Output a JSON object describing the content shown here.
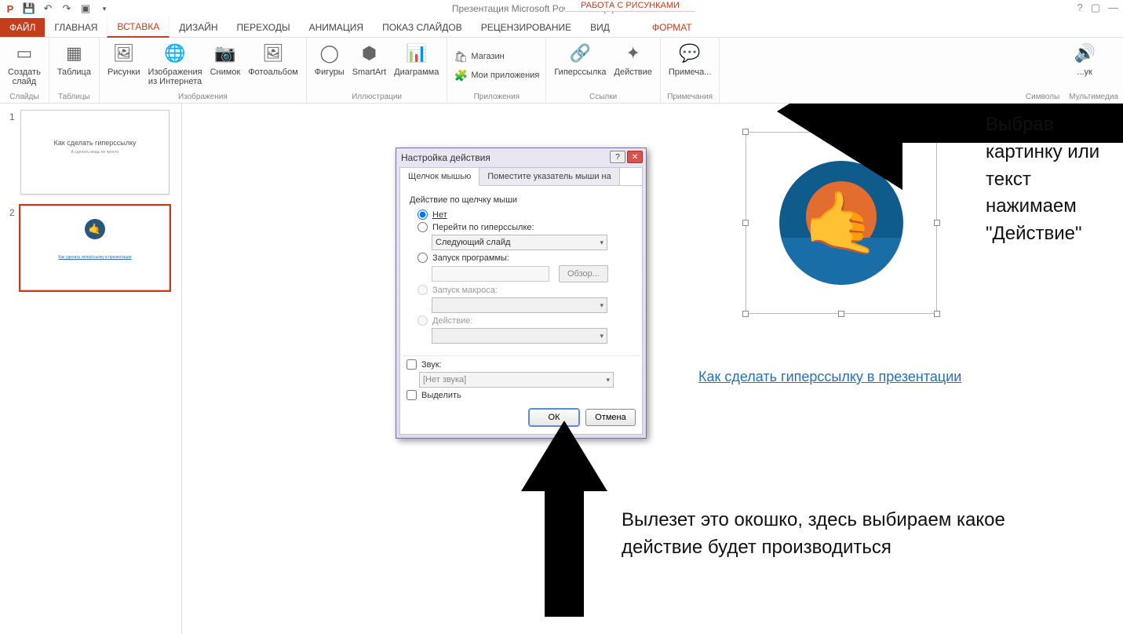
{
  "titlebar": {
    "title": "Презентация Microsoft PowerPoint (2) - PowerPoint",
    "tools_tab_group": "РАБОТА С РИСУНКАМИ"
  },
  "tabs": {
    "file": "ФАЙЛ",
    "home": "ГЛАВНАЯ",
    "insert": "ВСТАВКА",
    "design": "ДИЗАЙН",
    "transitions": "ПЕРЕХОДЫ",
    "animation": "АНИМАЦИЯ",
    "slideshow": "ПОКАЗ СЛАЙДОВ",
    "review": "РЕЦЕНЗИРОВАНИЕ",
    "view": "ВИД",
    "format": "ФОРМАТ"
  },
  "ribbon": {
    "slides": {
      "new_slide": "Создать\nслайд",
      "group": "Слайды"
    },
    "tables": {
      "table": "Таблица",
      "group": "Таблицы"
    },
    "images": {
      "pictures": "Рисунки",
      "online": "Изображения\nиз Интернета",
      "screenshot": "Снимок",
      "album": "Фотоальбом",
      "group": "Изображения"
    },
    "illustr": {
      "shapes": "Фигуры",
      "smartart": "SmartArt",
      "chart": "Диаграмма",
      "group": "Иллюстрации"
    },
    "apps": {
      "store": "Магазин",
      "myapps": "Мои приложения",
      "group": "Приложения"
    },
    "links": {
      "hyperlink": "Гиперссылка",
      "action": "Действие",
      "group": "Ссылки"
    },
    "notes": {
      "note": "Примеча...",
      "group": "Примечания"
    },
    "symbols": {
      "group": "Символы"
    },
    "media": {
      "sound": "...ук",
      "group": "Мультимедиа"
    }
  },
  "thumbs": {
    "n1": "1",
    "n2": "2",
    "t1_title": "Как сделать гиперссылку",
    "t1_sub": "А сделать вещь не просто",
    "t2_link": "Как сделать гиперссылку в презентации"
  },
  "dialog": {
    "title": "Настройка действия",
    "tab1": "Щелчок мышью",
    "tab2": "Поместите указатель мыши на",
    "group_title": "Действие по щелчку мыши",
    "opt_none": "Нет",
    "opt_hyper": "Перейти по гиперссылке:",
    "hyper_val": "Следующий слайд",
    "opt_prog": "Запуск программы:",
    "browse": "Обзор...",
    "opt_macro": "Запуск макроса:",
    "opt_action": "Действие:",
    "sound": "Звук:",
    "sound_val": "[Нет звука]",
    "highlight": "Выделить",
    "ok": "ОК",
    "cancel": "Отмена"
  },
  "slide": {
    "link_text": "Как сделать гиперссылку в презентации"
  },
  "annotations": {
    "a1": "Выбрав картинку или текст нажимаем \"Действие\"",
    "a2": "Вылезет это окошко, здесь выбираем какое действие будет производиться"
  }
}
